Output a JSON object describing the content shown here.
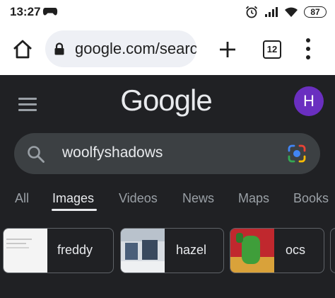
{
  "status_bar": {
    "time": "13:27",
    "battery": "87",
    "icons": [
      "gamepad-icon",
      "alarm-icon",
      "signal-icon",
      "wifi-icon",
      "battery-icon"
    ]
  },
  "browser": {
    "url": "google.com/search",
    "tab_count": "12",
    "icons": [
      "home-icon",
      "lock-icon",
      "plus-icon",
      "tabs-icon",
      "more-vert-icon"
    ]
  },
  "google": {
    "logo": "Google",
    "avatar_letter": "H",
    "search_query": "woolfyshadows",
    "tabs": [
      {
        "label": "All",
        "active": false
      },
      {
        "label": "Images",
        "active": true
      },
      {
        "label": "Videos",
        "active": false
      },
      {
        "label": "News",
        "active": false
      },
      {
        "label": "Maps",
        "active": false
      },
      {
        "label": "Books",
        "active": false
      }
    ],
    "chips": [
      {
        "label": "freddy"
      },
      {
        "label": "hazel"
      },
      {
        "label": "ocs"
      }
    ]
  },
  "colors": {
    "page_background": "#202124",
    "search_background": "#3c4043",
    "avatar": "#6a2fc0",
    "url_bar": "#eef0f5"
  }
}
